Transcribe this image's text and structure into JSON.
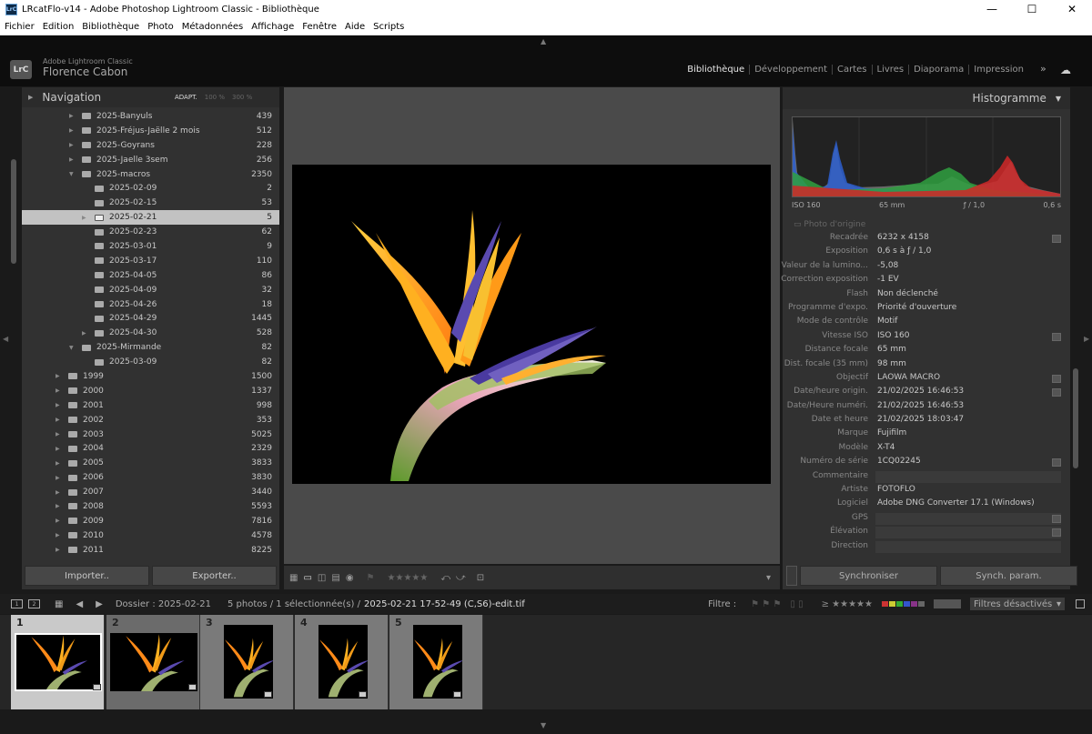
{
  "window": {
    "icon_text": "LrC",
    "title": "LRcatFlo-v14 - Adobe Photoshop Lightroom Classic - Bibliothèque",
    "controls": [
      "—",
      "☐",
      "✕"
    ]
  },
  "menu": [
    "Fichier",
    "Edition",
    "Bibliothèque",
    "Photo",
    "Métadonnées",
    "Affichage",
    "Fenêtre",
    "Aide",
    "Scripts"
  ],
  "identity": {
    "logo": "LrC",
    "line1": "Adobe Lightroom Classic",
    "line2": "Florence Cabon"
  },
  "modules": [
    "Bibliothèque",
    "Développement",
    "Cartes",
    "Livres",
    "Diaporama",
    "Impression"
  ],
  "modules_more": "»",
  "navigation": {
    "title": "Navigation",
    "zoom": [
      "ADAPT.",
      "100 %",
      "300 %"
    ]
  },
  "folders": [
    {
      "name": "2025-Banyuls",
      "count": "439",
      "level": 1,
      "state": "collapsed"
    },
    {
      "name": "2025-Fréjus-Jaëlle 2 mois",
      "count": "512",
      "level": 1,
      "state": "collapsed"
    },
    {
      "name": "2025-Goyrans",
      "count": "228",
      "level": 1,
      "state": "collapsed"
    },
    {
      "name": "2025-Jaelle 3sem",
      "count": "256",
      "level": 1,
      "state": "collapsed"
    },
    {
      "name": "2025-macros",
      "count": "2350",
      "level": 1,
      "state": "expanded"
    },
    {
      "name": "2025-02-09",
      "count": "2",
      "level": 2,
      "state": "none"
    },
    {
      "name": "2025-02-15",
      "count": "53",
      "level": 2,
      "state": "none"
    },
    {
      "name": "2025-02-21",
      "count": "5",
      "level": 2,
      "state": "collapsed",
      "selected": true
    },
    {
      "name": "2025-02-23",
      "count": "62",
      "level": 2,
      "state": "none"
    },
    {
      "name": "2025-03-01",
      "count": "9",
      "level": 2,
      "state": "none"
    },
    {
      "name": "2025-03-17",
      "count": "110",
      "level": 2,
      "state": "none"
    },
    {
      "name": "2025-04-05",
      "count": "86",
      "level": 2,
      "state": "none"
    },
    {
      "name": "2025-04-09",
      "count": "32",
      "level": 2,
      "state": "none"
    },
    {
      "name": "2025-04-26",
      "count": "18",
      "level": 2,
      "state": "none"
    },
    {
      "name": "2025-04-29",
      "count": "1445",
      "level": 2,
      "state": "none"
    },
    {
      "name": "2025-04-30",
      "count": "528",
      "level": 2,
      "state": "collapsed"
    },
    {
      "name": "2025-Mirmande",
      "count": "82",
      "level": 1,
      "state": "expanded"
    },
    {
      "name": "2025-03-09",
      "count": "82",
      "level": 2,
      "state": "none"
    },
    {
      "name": "1999",
      "count": "1500",
      "level": 0,
      "state": "collapsed"
    },
    {
      "name": "2000",
      "count": "1337",
      "level": 0,
      "state": "collapsed"
    },
    {
      "name": "2001",
      "count": "998",
      "level": 0,
      "state": "collapsed"
    },
    {
      "name": "2002",
      "count": "353",
      "level": 0,
      "state": "collapsed"
    },
    {
      "name": "2003",
      "count": "5025",
      "level": 0,
      "state": "collapsed"
    },
    {
      "name": "2004",
      "count": "2329",
      "level": 0,
      "state": "collapsed"
    },
    {
      "name": "2005",
      "count": "3833",
      "level": 0,
      "state": "collapsed"
    },
    {
      "name": "2006",
      "count": "3830",
      "level": 0,
      "state": "collapsed"
    },
    {
      "name": "2007",
      "count": "3440",
      "level": 0,
      "state": "collapsed"
    },
    {
      "name": "2008",
      "count": "5593",
      "level": 0,
      "state": "collapsed"
    },
    {
      "name": "2009",
      "count": "7816",
      "level": 0,
      "state": "collapsed"
    },
    {
      "name": "2010",
      "count": "4578",
      "level": 0,
      "state": "collapsed"
    },
    {
      "name": "2011",
      "count": "8225",
      "level": 0,
      "state": "collapsed"
    }
  ],
  "left_buttons": {
    "import": "Importer..",
    "export": "Exporter.."
  },
  "toolbar": {
    "stars": "★★★★★"
  },
  "histogram": {
    "title": "Histogramme",
    "iso": "ISO 160",
    "focal": "65 mm",
    "aperture": "ƒ / 1,0",
    "shutter": "0,6 s",
    "original": "Photo d'origine"
  },
  "metadata": [
    {
      "label": "Recadrée",
      "value": "6232 x 4158",
      "icon": true
    },
    {
      "label": "Exposition",
      "value": "0,6 s à ƒ / 1,0"
    },
    {
      "label": "Valeur de la lumino...",
      "value": "-5,08"
    },
    {
      "label": "Correction exposition",
      "value": "-1 EV"
    },
    {
      "label": "Flash",
      "value": "Non déclenché"
    },
    {
      "label": "Programme d'expo.",
      "value": "Priorité d'ouverture"
    },
    {
      "label": "Mode de contrôle",
      "value": "Motif"
    },
    {
      "label": "Vitesse ISO",
      "value": "ISO 160",
      "icon": true
    },
    {
      "label": "Distance focale",
      "value": "65 mm"
    },
    {
      "label": "Dist. focale (35 mm)",
      "value": "98 mm"
    },
    {
      "label": "Objectif",
      "value": "LAOWA MACRO",
      "icon": true
    },
    {
      "label": "Date/heure origin.",
      "value": "21/02/2025 16:46:53",
      "icon": true
    },
    {
      "label": "Date/Heure numéri.",
      "value": "21/02/2025 16:46:53"
    },
    {
      "label": "Date et heure",
      "value": "21/02/2025 18:03:47"
    },
    {
      "label": "Marque",
      "value": "Fujifilm"
    },
    {
      "label": "Modèle",
      "value": "X-T4"
    },
    {
      "label": "Numéro de série",
      "value": "1CQ02245",
      "icon": true
    },
    {
      "label": "Commentaire",
      "value": "",
      "box": true
    },
    {
      "label": "Artiste",
      "value": "FOTOFLO"
    },
    {
      "label": "Logiciel",
      "value": "Adobe DNG Converter 17.1 (Windows)"
    },
    {
      "label": "GPS",
      "value": "",
      "box": true,
      "icon": true
    },
    {
      "label": "Élévation",
      "value": "",
      "box": true,
      "icon": true
    },
    {
      "label": "Direction",
      "value": "",
      "box": true
    }
  ],
  "right_buttons": {
    "sync": "Synchroniser",
    "sync_settings": "Synch. param."
  },
  "filmstrip_bar": {
    "screen1": "1",
    "screen2": "2",
    "folder": "Dossier : 2025-02-21",
    "count": "5 photos / 1 sélectionnée(s) /",
    "filename": "2025-02-21 17-52-49 (C,S6)-edit.tif",
    "filter_label": "Filtre :",
    "filter_value": "Filtres désactivés"
  },
  "thumbnails": [
    {
      "num": "1",
      "selected": true,
      "orientation": "landscape"
    },
    {
      "num": "2",
      "selected": false,
      "orientation": "landscape"
    },
    {
      "num": "3",
      "selected": false,
      "orientation": "portrait"
    },
    {
      "num": "4",
      "selected": false,
      "orientation": "portrait"
    },
    {
      "num": "5",
      "selected": false,
      "orientation": "portrait"
    }
  ]
}
